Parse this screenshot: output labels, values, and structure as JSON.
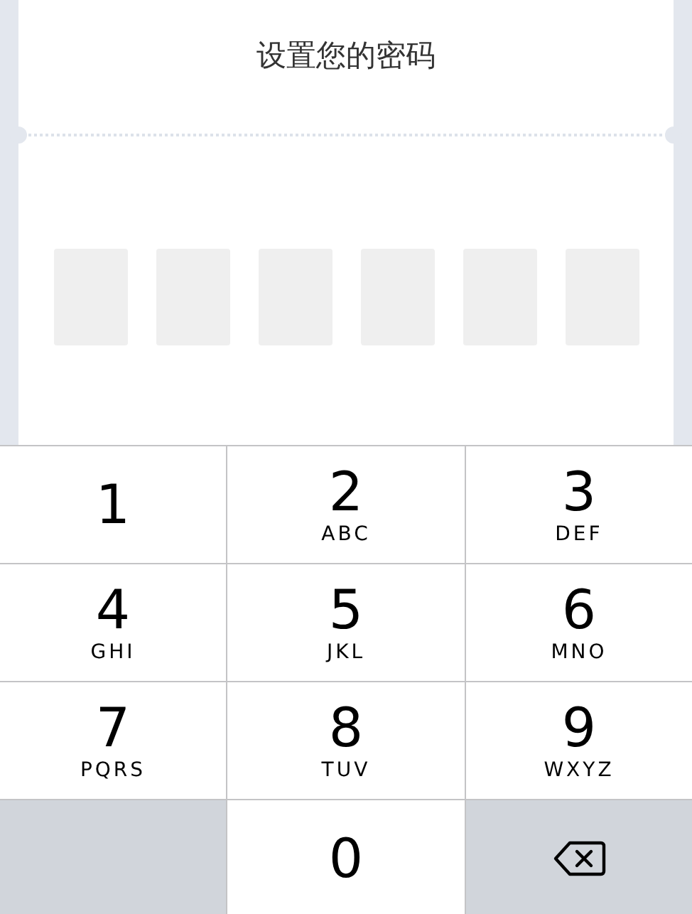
{
  "title": "设置您的密码",
  "code_boxes": [
    {
      "filled": false
    },
    {
      "filled": false
    },
    {
      "filled": false
    },
    {
      "filled": false
    },
    {
      "filled": false
    },
    {
      "filled": false
    }
  ],
  "keypad": [
    {
      "kind": "digit",
      "digit": "1"
    },
    {
      "kind": "digit",
      "digit": "2",
      "letters": "ABC"
    },
    {
      "kind": "digit",
      "digit": "3",
      "letters": "DEF"
    },
    {
      "kind": "digit",
      "digit": "4",
      "letters": "GHI"
    },
    {
      "kind": "digit",
      "digit": "5",
      "letters": "JKL"
    },
    {
      "kind": "digit",
      "digit": "6",
      "letters": "MNO"
    },
    {
      "kind": "digit",
      "digit": "7",
      "letters": "PQRS"
    },
    {
      "kind": "digit",
      "digit": "8",
      "letters": "TUV"
    },
    {
      "kind": "digit",
      "digit": "9",
      "letters": "WXYZ"
    },
    {
      "kind": "blank"
    },
    {
      "kind": "digit",
      "digit": "0"
    },
    {
      "kind": "backspace"
    }
  ]
}
